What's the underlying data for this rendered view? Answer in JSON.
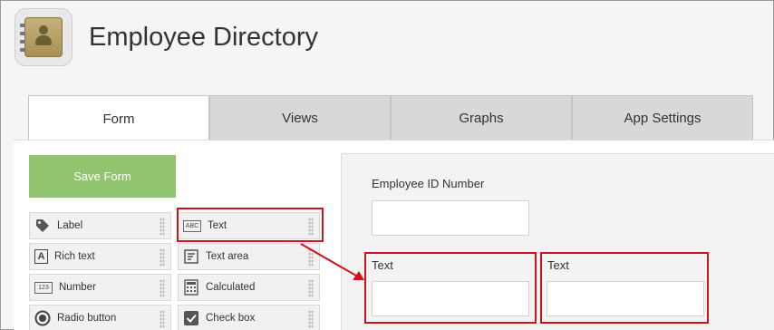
{
  "app": {
    "title": "Employee Directory",
    "icon": "address-book-icon"
  },
  "tabs": [
    {
      "label": "Form",
      "active": true
    },
    {
      "label": "Views",
      "active": false
    },
    {
      "label": "Graphs",
      "active": false
    },
    {
      "label": "App Settings",
      "active": false
    }
  ],
  "palette": {
    "save_label": "Save Form",
    "items": [
      {
        "label": "Label",
        "icon": "tag-icon"
      },
      {
        "label": "Text",
        "icon": "abc-text-icon",
        "icon_text": "ABC"
      },
      {
        "label": "Rich text",
        "icon": "rich-text-icon",
        "icon_text": "A"
      },
      {
        "label": "Text area",
        "icon": "text-area-icon"
      },
      {
        "label": "Number",
        "icon": "number-icon",
        "icon_text": "123"
      },
      {
        "label": "Calculated",
        "icon": "calculator-icon"
      },
      {
        "label": "Radio button",
        "icon": "radio-button-icon"
      },
      {
        "label": "Check box",
        "icon": "checkbox-icon"
      }
    ]
  },
  "form": {
    "employee_id_label": "Employee ID Number",
    "text_field_1_label": "Text",
    "text_field_2_label": "Text"
  },
  "colors": {
    "save_button": "#91c46f",
    "highlight": "#d0121b",
    "active_tab": "#ffffff",
    "inactive_tab": "#d8d8d8"
  }
}
